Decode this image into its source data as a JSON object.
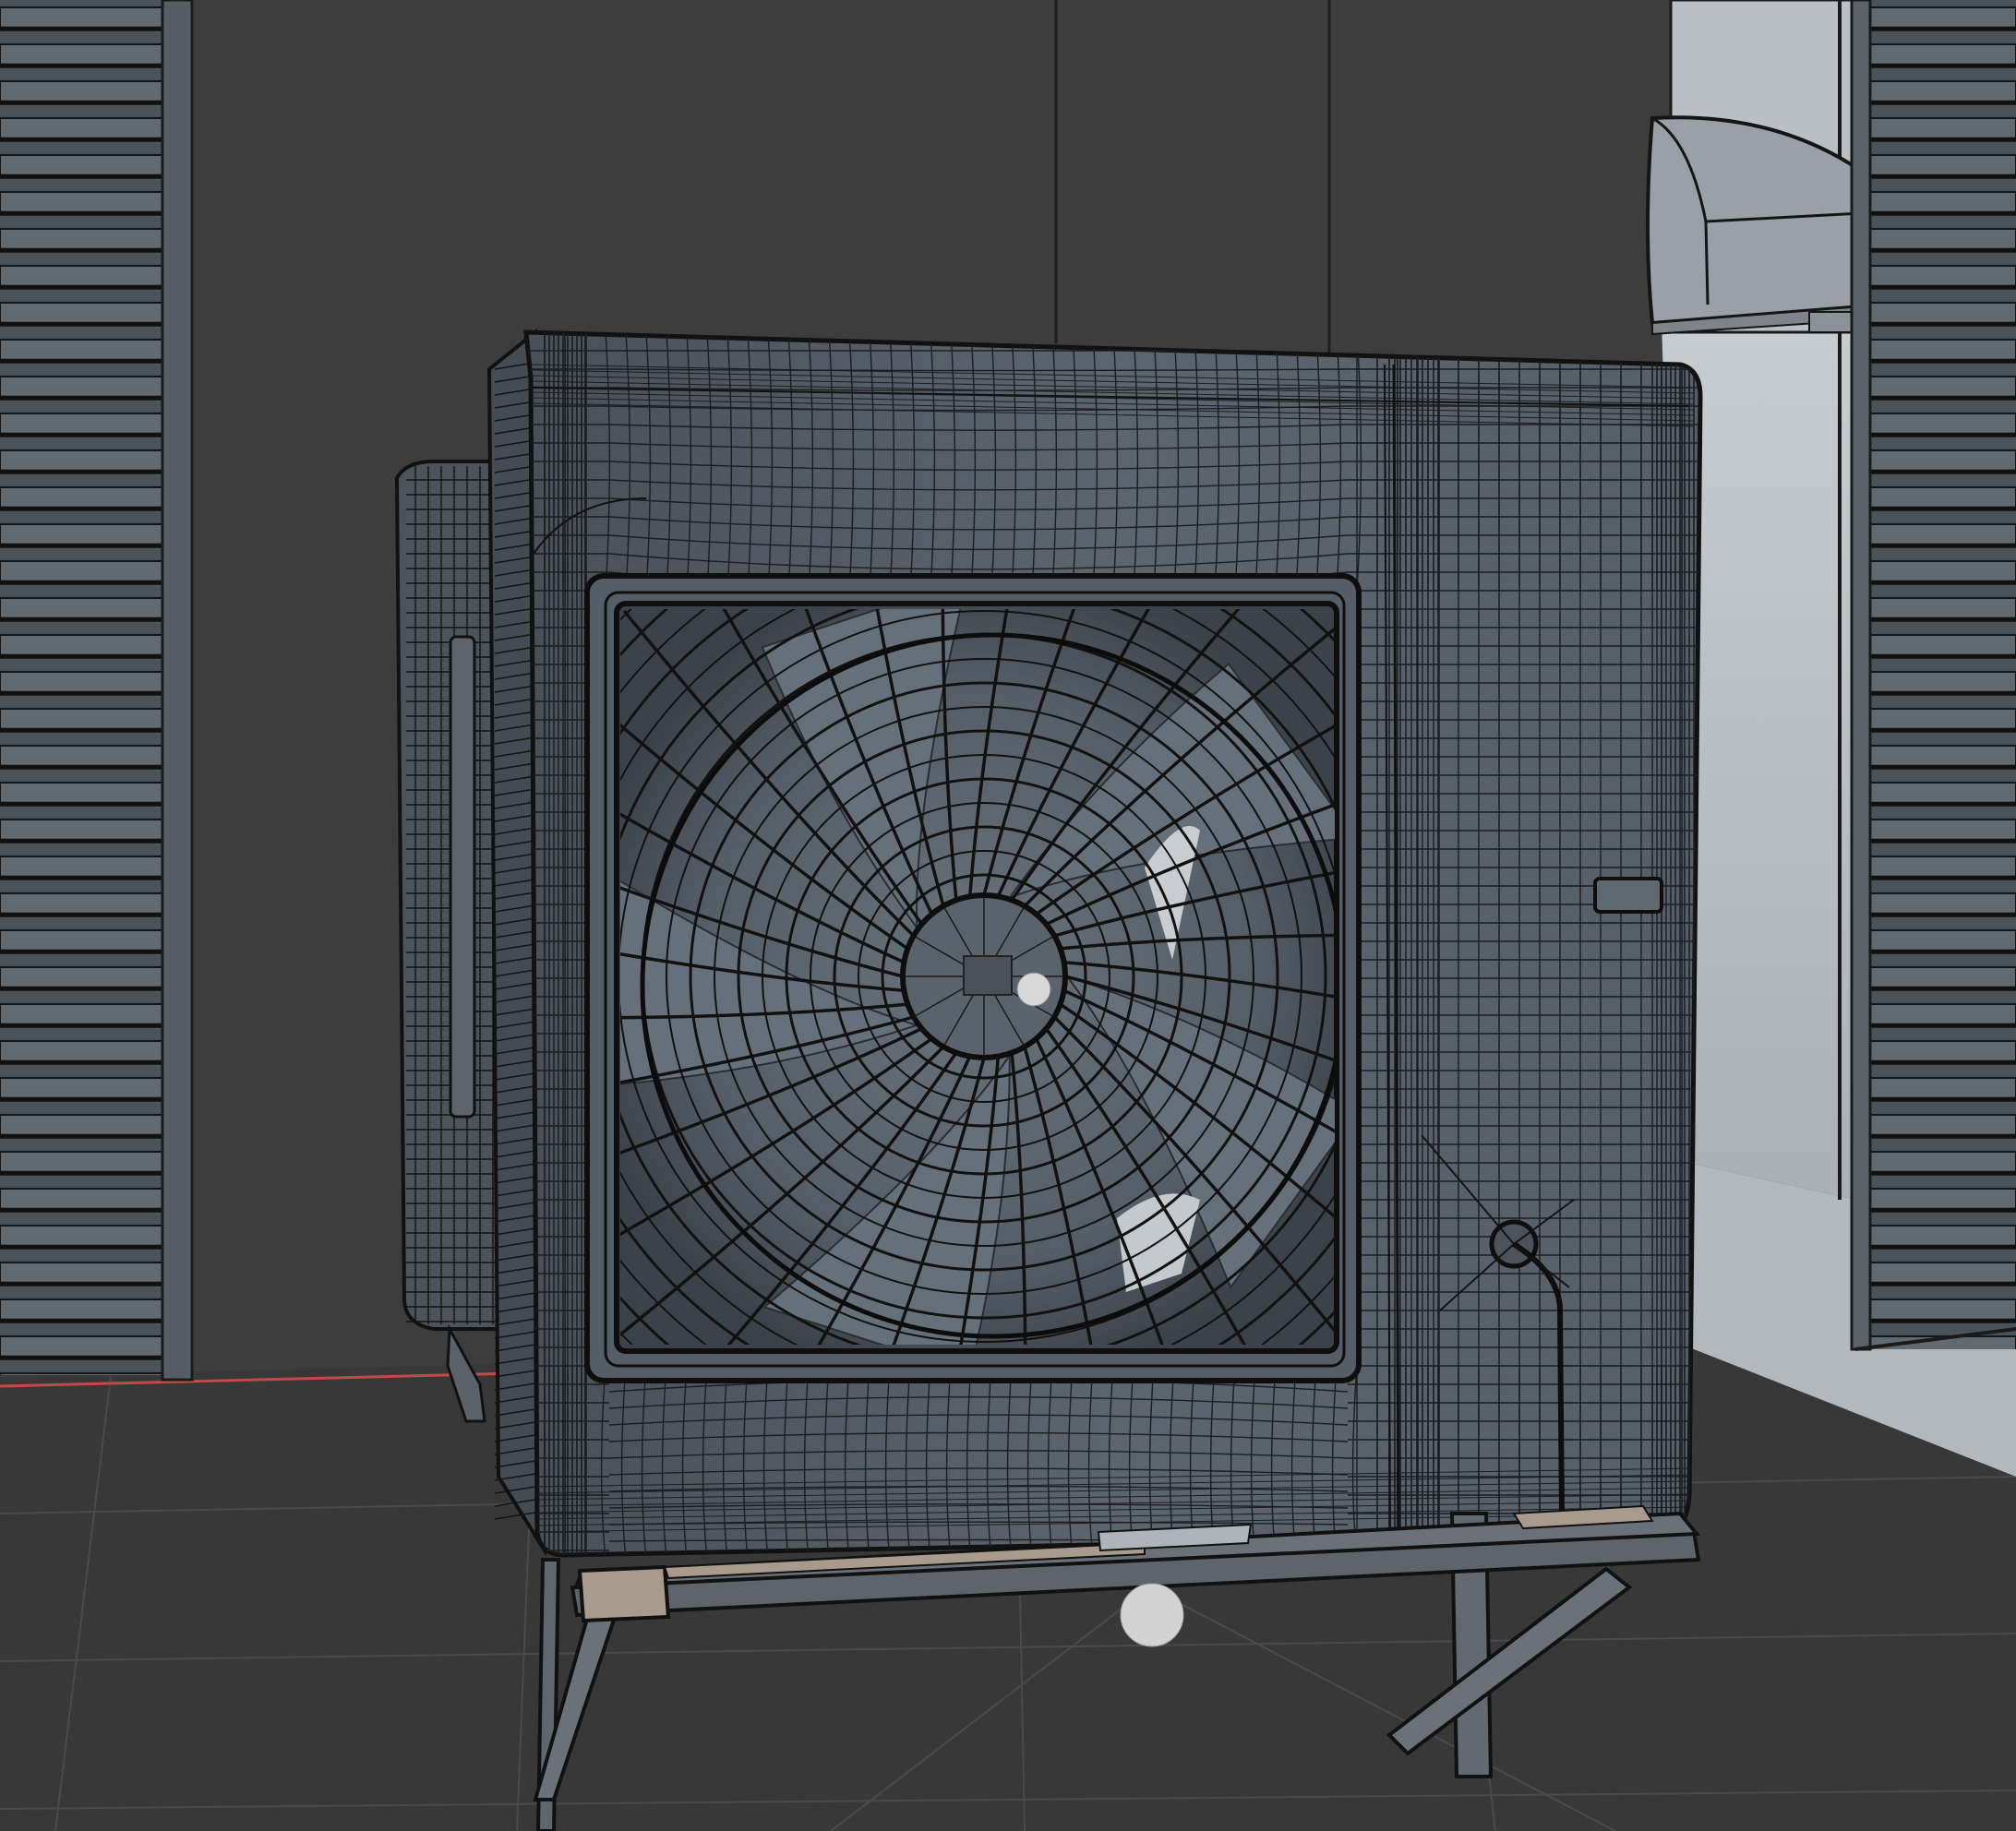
{
  "viewport": {
    "background": "#3d3d3d",
    "floor_color": "#373737",
    "wire_color": "#1a1a1a",
    "mesh_color": "#5d6570",
    "highlight_color": "#aeb4bb",
    "x_axis_color": "#c24a4a",
    "wood_color": "#a89a8c"
  }
}
